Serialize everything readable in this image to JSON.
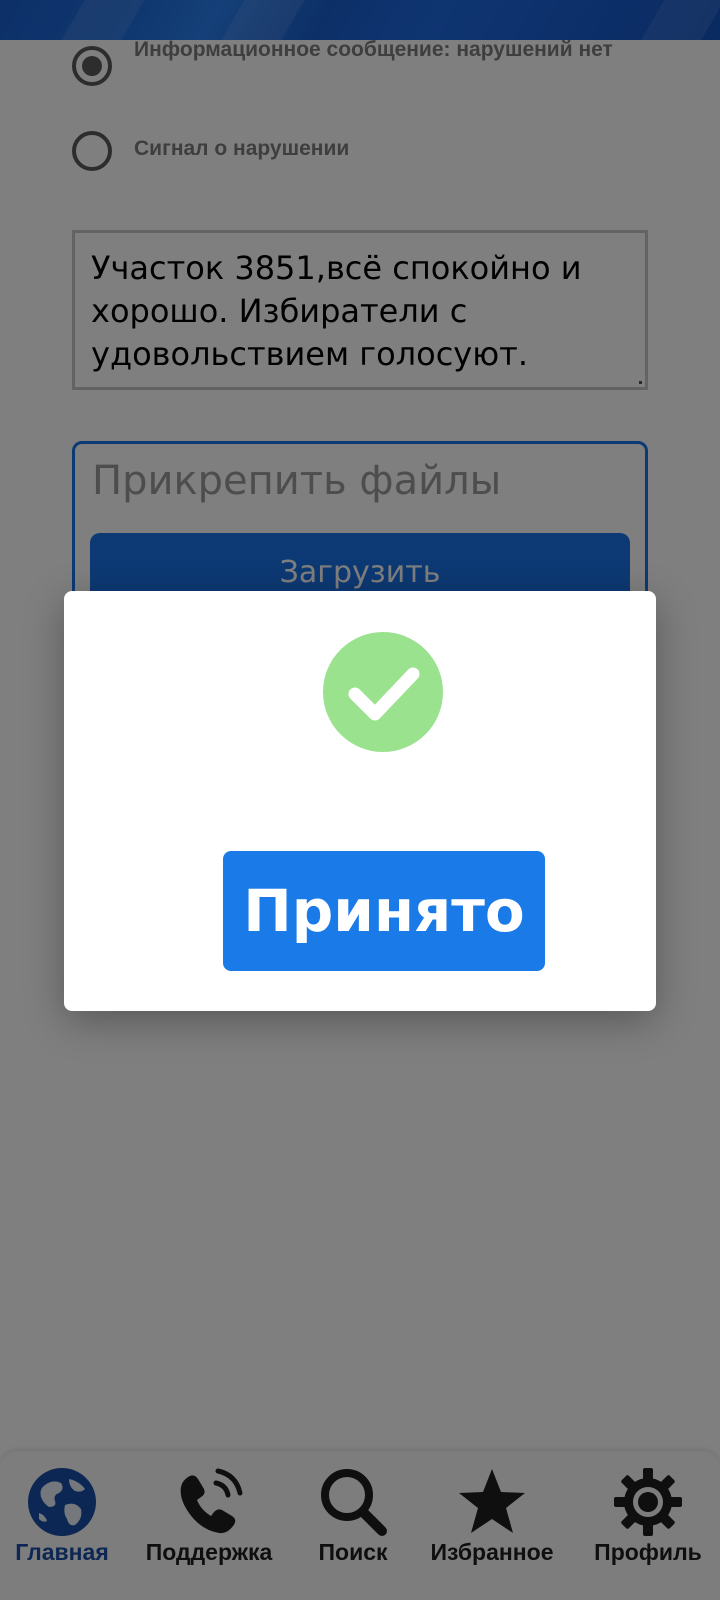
{
  "form": {
    "radio_options": [
      {
        "label": "Информационное сообщение: нарушений нет",
        "selected": true
      },
      {
        "label": "Сигнал о нарушении",
        "selected": false
      }
    ],
    "message_text": "Участок 3851,всё спокойно и хорошо. Избиратели с удовольствием голосуют.",
    "attach_title": "Прикрепить файлы",
    "upload_label": "Загрузить"
  },
  "dialog": {
    "icon": "check-circle-icon",
    "icon_color": "#9be28f",
    "button_label": "Принято",
    "button_color": "#1a7ae8"
  },
  "bottom_nav": {
    "active": "home",
    "items": [
      {
        "id": "home",
        "label": "Главная",
        "icon": "globe-icon"
      },
      {
        "id": "support",
        "label": "Поддержка",
        "icon": "phone-icon"
      },
      {
        "id": "search",
        "label": "Поиск",
        "icon": "search-icon"
      },
      {
        "id": "favorites",
        "label": "Избранное",
        "icon": "star-icon"
      },
      {
        "id": "profile",
        "label": "Профиль",
        "icon": "gear-icon"
      }
    ]
  },
  "colors": {
    "accent": "#1a73e8",
    "overlay": "rgba(0,0,0,0.5)",
    "success": "#9be28f"
  }
}
